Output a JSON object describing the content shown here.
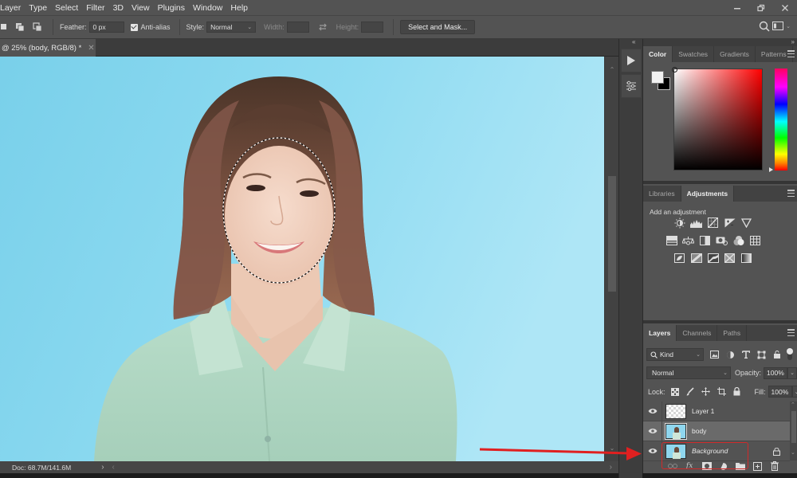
{
  "menu": [
    "Layer",
    "Type",
    "Select",
    "Filter",
    "3D",
    "View",
    "Plugins",
    "Window",
    "Help"
  ],
  "window_controls": {
    "minimize": "minimize-icon",
    "restore": "restore-icon",
    "close": "close-icon"
  },
  "options_bar": {
    "feather_label": "Feather:",
    "feather_value": "0 px",
    "antialias_label": "Anti-alias",
    "antialias_checked": true,
    "style_label": "Style:",
    "style_value": "Normal",
    "width_label": "Width:",
    "height_label": "Height:",
    "select_mask_label": "Select and Mask..."
  },
  "document": {
    "tab_title": "@ 25% (body, RGB/8) *",
    "status": "Doc: 68.7M/141.6M"
  },
  "color_panel": {
    "tabs": [
      "Color",
      "Swatches",
      "Gradients",
      "Patterns"
    ],
    "active_tab": "Color",
    "foreground": "#f2f2f2",
    "background": "#000000",
    "hue": "#ff0000"
  },
  "adjustments_panel": {
    "tabs": [
      "Libraries",
      "Adjustments"
    ],
    "active_tab": "Adjustments",
    "title": "Add an adjustment",
    "rows": [
      [
        "brightness-contrast",
        "levels",
        "curves",
        "exposure",
        "vibrance"
      ],
      [
        "hue-saturation",
        "color-balance",
        "black-white",
        "photo-filter",
        "channel-mixer",
        "color-lookup"
      ],
      [
        "invert",
        "posterize",
        "threshold",
        "selective-color",
        "gradient-map"
      ]
    ]
  },
  "layers_panel": {
    "tabs": [
      "Layers",
      "Channels",
      "Paths"
    ],
    "active_tab": "Layers",
    "filter_kind": "Kind",
    "blend_mode": "Normal",
    "opacity_label": "Opacity:",
    "opacity_value": "100%",
    "lock_label": "Lock:",
    "fill_label": "Fill:",
    "fill_value": "100%",
    "layers": [
      {
        "name": "Layer 1",
        "visible": true,
        "selected": false,
        "thumbnail": "transparent",
        "locked": false,
        "italic": false
      },
      {
        "name": "body",
        "visible": true,
        "selected": true,
        "thumbnail": "photo",
        "locked": false,
        "italic": false
      },
      {
        "name": "Background",
        "visible": true,
        "selected": false,
        "thumbnail": "photo",
        "locked": true,
        "italic": true
      }
    ]
  },
  "annotation": {
    "arrow_color": "#e02020",
    "highlight_target": "Background"
  }
}
